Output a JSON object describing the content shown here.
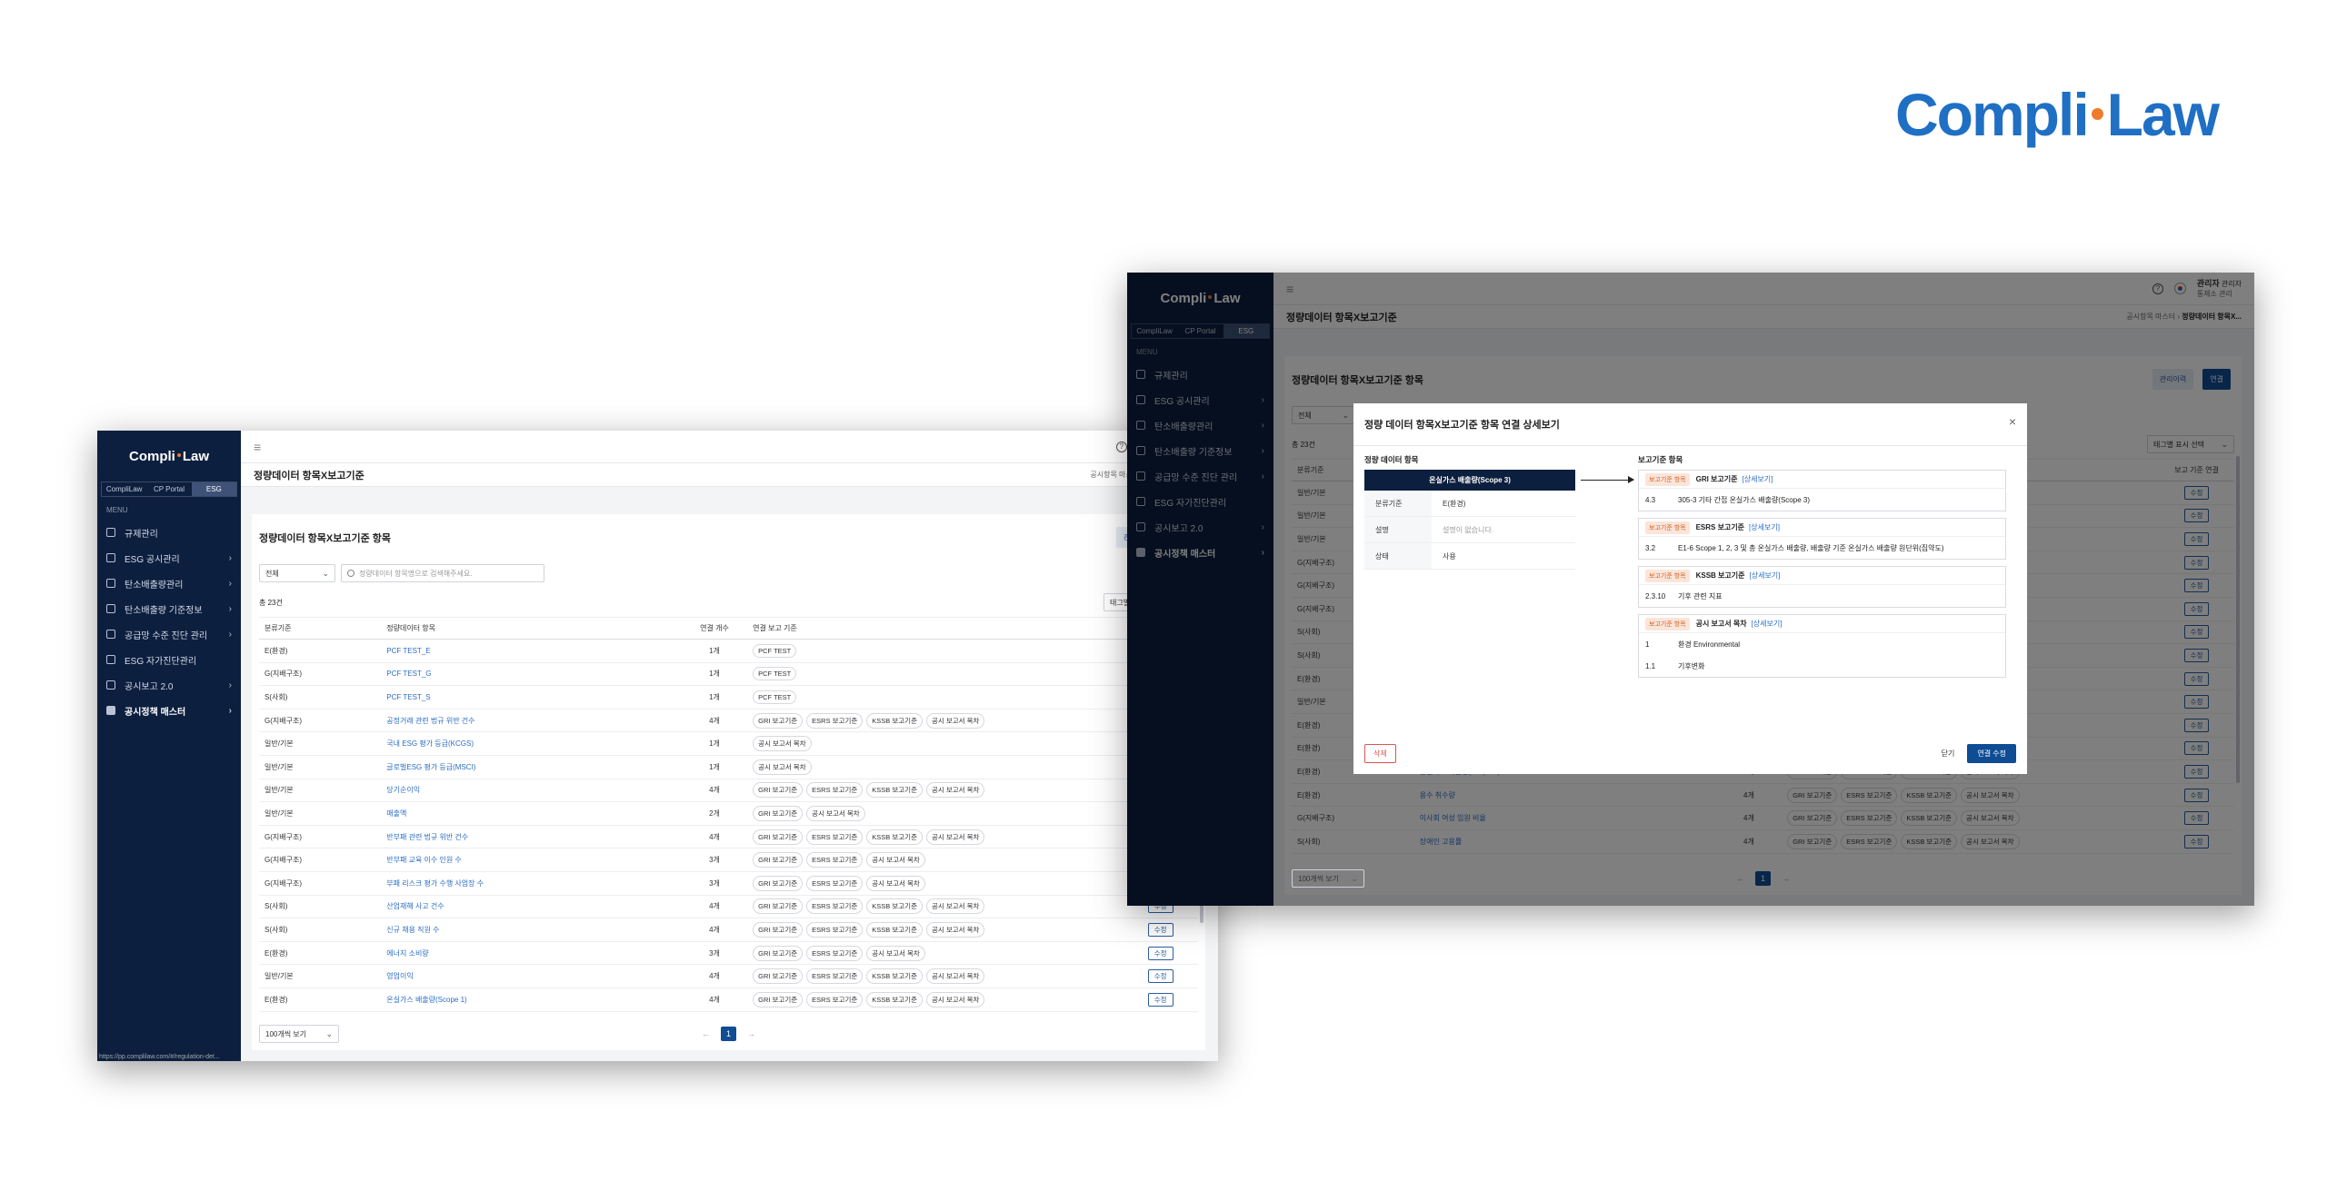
{
  "brand": {
    "left": "Compli",
    "right": "Law"
  },
  "sidebar": {
    "logo_left": "Compli",
    "logo_right": "Law",
    "tabs": [
      "CompliLaw",
      "CP Portal",
      "ESG"
    ],
    "menu_header": "MENU",
    "items": [
      {
        "label": "규제관리",
        "icon": "regulation-icon"
      },
      {
        "label": "ESG 공시관리",
        "icon": "disclosure-icon"
      },
      {
        "label": "탄소배출량관리",
        "icon": "carbon-icon"
      },
      {
        "label": "탄소배출량 기준정보",
        "icon": "carbon-standard-icon"
      },
      {
        "label": "공급망 수준 진단 관리",
        "icon": "chart-icon"
      },
      {
        "label": "ESG 자가진단관리",
        "icon": "checklist-icon"
      },
      {
        "label": "공시보고 2.0",
        "icon": "report-icon"
      },
      {
        "label": "공시정책 매스터",
        "icon": "master-icon"
      }
    ]
  },
  "topbar": {
    "user_name": "관리자",
    "user_role": "관리자",
    "user_sub": "통제소 관리"
  },
  "page": {
    "title": "정량데이터 항목X보고기준",
    "breadcrumb_parent": "공시항목 마스터",
    "breadcrumb_current": "정량데이터 항목X..."
  },
  "card": {
    "title": "정량데이터 항목X보고기준 항목",
    "btn_manager": "관리이력",
    "btn_link": "연결",
    "filter_value": "전체",
    "search_placeholder": "정량데이터 항목명으로 검색해주세요.",
    "total": "총 23건",
    "tag_filter": "태그별 표시 선택",
    "per_page": "100개씩 보기",
    "page_current": "1",
    "edit_label": "수정"
  },
  "table": {
    "headers": [
      "분류기준",
      "정량데이터 항목",
      "연결 개수",
      "연결 보고 기준",
      "보고 기준 연결"
    ],
    "rows": [
      {
        "cat": "E(환경)",
        "item": "PCF TEST_E",
        "count": "1개",
        "tags": [
          "PCF TEST"
        ]
      },
      {
        "cat": "G(지배구조)",
        "item": "PCF TEST_G",
        "count": "1개",
        "tags": [
          "PCF TEST"
        ]
      },
      {
        "cat": "S(사회)",
        "item": "PCF TEST_S",
        "count": "1개",
        "tags": [
          "PCF TEST"
        ]
      },
      {
        "cat": "G(지배구조)",
        "item": "공정거래 관련 법규 위반 건수",
        "count": "4개",
        "tags": [
          "GRI 보고기준",
          "ESRS 보고기준",
          "KSSB 보고기준",
          "공시 보고서 목차"
        ]
      },
      {
        "cat": "일반/기본",
        "item": "국내 ESG 평가 등급(KCGS)",
        "count": "1개",
        "tags": [
          "공시 보고서 목차"
        ]
      },
      {
        "cat": "일반/기본",
        "item": "글로벌ESG 평가 등급(MSCI)",
        "count": "1개",
        "tags": [
          "공시 보고서 목차"
        ]
      },
      {
        "cat": "일반/기본",
        "item": "당기순이익",
        "count": "4개",
        "tags": [
          "GRI 보고기준",
          "ESRS 보고기준",
          "KSSB 보고기준",
          "공시 보고서 목차"
        ]
      },
      {
        "cat": "일반/기본",
        "item": "매출액",
        "count": "2개",
        "tags": [
          "GRI 보고기준",
          "공시 보고서 목차"
        ]
      },
      {
        "cat": "G(지배구조)",
        "item": "반부패 관련 법규 위반 건수",
        "count": "4개",
        "tags": [
          "GRI 보고기준",
          "ESRS 보고기준",
          "KSSB 보고기준",
          "공시 보고서 목차"
        ]
      },
      {
        "cat": "G(지배구조)",
        "item": "반부패 교육 이수 인원 수",
        "count": "3개",
        "tags": [
          "GRI 보고기준",
          "ESRS 보고기준",
          "공시 보고서 목차"
        ]
      },
      {
        "cat": "G(지배구조)",
        "item": "부패 리스크 평가 수행 사업장 수",
        "count": "3개",
        "tags": [
          "GRI 보고기준",
          "ESRS 보고기준",
          "공시 보고서 목차"
        ]
      },
      {
        "cat": "S(사회)",
        "item": "산업재해 사고 건수",
        "count": "4개",
        "tags": [
          "GRI 보고기준",
          "ESRS 보고기준",
          "KSSB 보고기준",
          "공시 보고서 목차"
        ]
      },
      {
        "cat": "S(사회)",
        "item": "신규 채용 직원 수",
        "count": "4개",
        "tags": [
          "GRI 보고기준",
          "ESRS 보고기준",
          "KSSB 보고기준",
          "공시 보고서 목차"
        ]
      },
      {
        "cat": "E(환경)",
        "item": "에너지 소비량",
        "count": "3개",
        "tags": [
          "GRI 보고기준",
          "ESRS 보고기준",
          "공시 보고서 목차"
        ]
      },
      {
        "cat": "일반/기본",
        "item": "영업이익",
        "count": "4개",
        "tags": [
          "GRI 보고기준",
          "ESRS 보고기준",
          "KSSB 보고기준",
          "공시 보고서 목차"
        ]
      },
      {
        "cat": "E(환경)",
        "item": "온실가스 배출량(Scope 1)",
        "count": "4개",
        "tags": [
          "GRI 보고기준",
          "ESRS 보고기준",
          "KSSB 보고기준",
          "공시 보고서 목차"
        ]
      }
    ]
  },
  "table2": {
    "rows": [
      {
        "cat": "일반/기본",
        "count": "",
        "tags": []
      },
      {
        "cat": "일반/기본",
        "count": "",
        "tags": []
      },
      {
        "cat": "일반/기본",
        "count": "",
        "tags": []
      },
      {
        "cat": "G(지배구조)",
        "count": "",
        "tags": []
      },
      {
        "cat": "G(지배구조)",
        "count": "",
        "tags": []
      },
      {
        "cat": "G(지배구조)",
        "count": "",
        "tags": []
      },
      {
        "cat": "S(사회)",
        "count": "",
        "tags": []
      },
      {
        "cat": "S(사회)",
        "count": "",
        "tags": []
      },
      {
        "cat": "E(환경)",
        "count": "",
        "tags": []
      },
      {
        "cat": "일반/기본",
        "count": "",
        "tags": []
      },
      {
        "cat": "E(환경)",
        "count": "",
        "tags": []
      },
      {
        "cat": "E(환경)",
        "count": "",
        "tags": []
      },
      {
        "cat": "E(환경)",
        "count": "4개",
        "item": "온실가스 배출량(Scope 3)",
        "tags": [
          "GRI 보고기준",
          "ESRS 보고기준",
          "KSSB 보고기준",
          "공시 보고서 목차"
        ]
      },
      {
        "cat": "E(환경)",
        "count": "4개",
        "item": "용수 취수량",
        "tags": [
          "GRI 보고기준",
          "ESRS 보고기준",
          "KSSB 보고기준",
          "공시 보고서 목차"
        ]
      },
      {
        "cat": "G(지배구조)",
        "count": "4개",
        "item": "이사회 여성 임원 비율",
        "tags": [
          "GRI 보고기준",
          "ESRS 보고기준",
          "KSSB 보고기준",
          "공시 보고서 목차"
        ]
      },
      {
        "cat": "S(사회)",
        "count": "4개",
        "item": "장애인 고용률",
        "tags": [
          "GRI 보고기준",
          "ESRS 보고기준",
          "KSSB 보고기준",
          "공시 보고서 목차"
        ]
      }
    ]
  },
  "modal": {
    "title": "정량 데이터 항목X보고기준 항목 연결 상세보기",
    "left_header": "정량 데이터 항목",
    "item_name": "온실가스 배출량(Scope 3)",
    "fields": [
      {
        "key": "분류기준",
        "value": "E(환경)"
      },
      {
        "key": "설명",
        "value": "설명이 없습니다."
      },
      {
        "key": "상태",
        "value": "사용"
      }
    ],
    "right_header": "보고기준 항목",
    "badge": "보고기준 항목",
    "detail_link": "[상세보기]",
    "groups": [
      {
        "name": "GRI 보고기준",
        "rows": [
          {
            "no": "4.3",
            "text": "305-3 기타 간접 온실가스 배출량(Scope 3)"
          }
        ]
      },
      {
        "name": "ESRS 보고기준",
        "rows": [
          {
            "no": "3.2",
            "text": "E1-6 Scope 1, 2, 3 및 총 온실가스 배출량, 배출량 기준 온실가스 배출량 원단위(집약도)"
          }
        ]
      },
      {
        "name": "KSSB 보고기준",
        "rows": [
          {
            "no": "2.3.10",
            "text": "기후 관련 지표"
          }
        ]
      },
      {
        "name": "공시 보고서 목차",
        "rows": [
          {
            "no": "1",
            "text": "환경 Environmental"
          },
          {
            "no": "1.1",
            "text": "기후변화"
          }
        ]
      }
    ],
    "delete": "삭제",
    "close": "닫기",
    "submit": "연결 수정"
  },
  "status_url": "https://pp.complilaw.com/#/regulation-det..."
}
